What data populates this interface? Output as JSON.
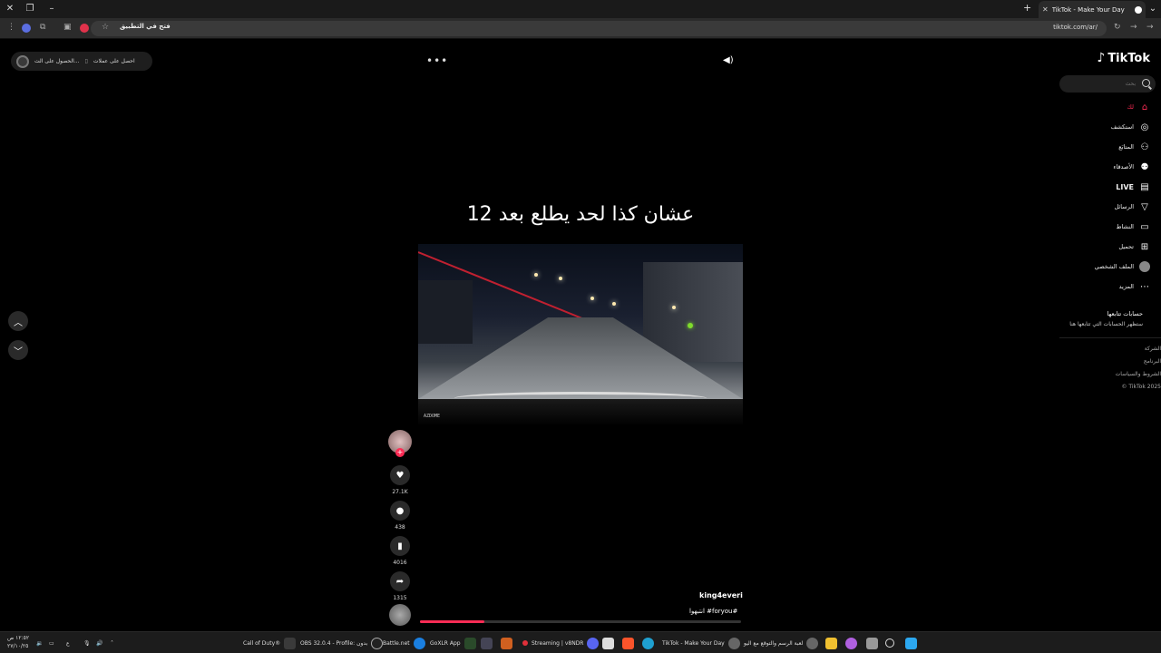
{
  "browser": {
    "tab_title": "TikTok - Make Your Day",
    "url": "tiktok.com/ar/",
    "open_in_app": "فتح في التطبيق"
  },
  "promo": {
    "get_coins": "احصل على عملات",
    "get_app": "الحصول على الت..."
  },
  "sidebar": {
    "logo": "TikTok",
    "search_placeholder": "بحث",
    "nav": [
      {
        "label": "لك",
        "icon": "home-icon"
      },
      {
        "label": "استكشف",
        "icon": "compass-icon"
      },
      {
        "label": "المتابَع",
        "icon": "following-icon"
      },
      {
        "label": "الأصدقاء",
        "icon": "friends-icon"
      },
      {
        "label": "LIVE",
        "icon": "live-icon"
      },
      {
        "label": "الرسائل",
        "icon": "messages-icon"
      },
      {
        "label": "النشاط",
        "icon": "activity-icon"
      },
      {
        "label": "تحميل",
        "icon": "upload-icon"
      },
      {
        "label": "الملف الشخصي",
        "icon": "profile-icon"
      },
      {
        "label": "المزيد",
        "icon": "more-icon"
      }
    ],
    "following_title": "حسابات تتابعها",
    "following_hint": "ستظهر الحسابات التي تتابعها هنا",
    "footer": [
      "الشركة",
      "البرنامج",
      "الشروط والسياسات",
      "© TikTok 2025"
    ]
  },
  "video": {
    "caption": "عشان كذا لحد يطلع بعد 12",
    "dashcam_brand": "AZDOME",
    "author": "king4everi",
    "hashtags": "#foryou# انتبهوا",
    "progress": 0.2
  },
  "actions": {
    "likes": "27.1K",
    "comments": "438",
    "saves": "4016",
    "shares": "1315"
  },
  "taskbar": {
    "items": [
      "Call of Duty®",
      "OBS 32.0.4 - Profile: بدون",
      "Battle.net",
      "GoXLR App",
      "Streaming | v8NDR",
      "TikTok - Make Your Day",
      "لعبة الرسم والتوقع مع اليو"
    ],
    "time": "١٢:٥٢ ص",
    "date": "٢٧/١٠/٢٥"
  },
  "colors": {
    "accent": "#fe2c55",
    "background": "#000000"
  }
}
